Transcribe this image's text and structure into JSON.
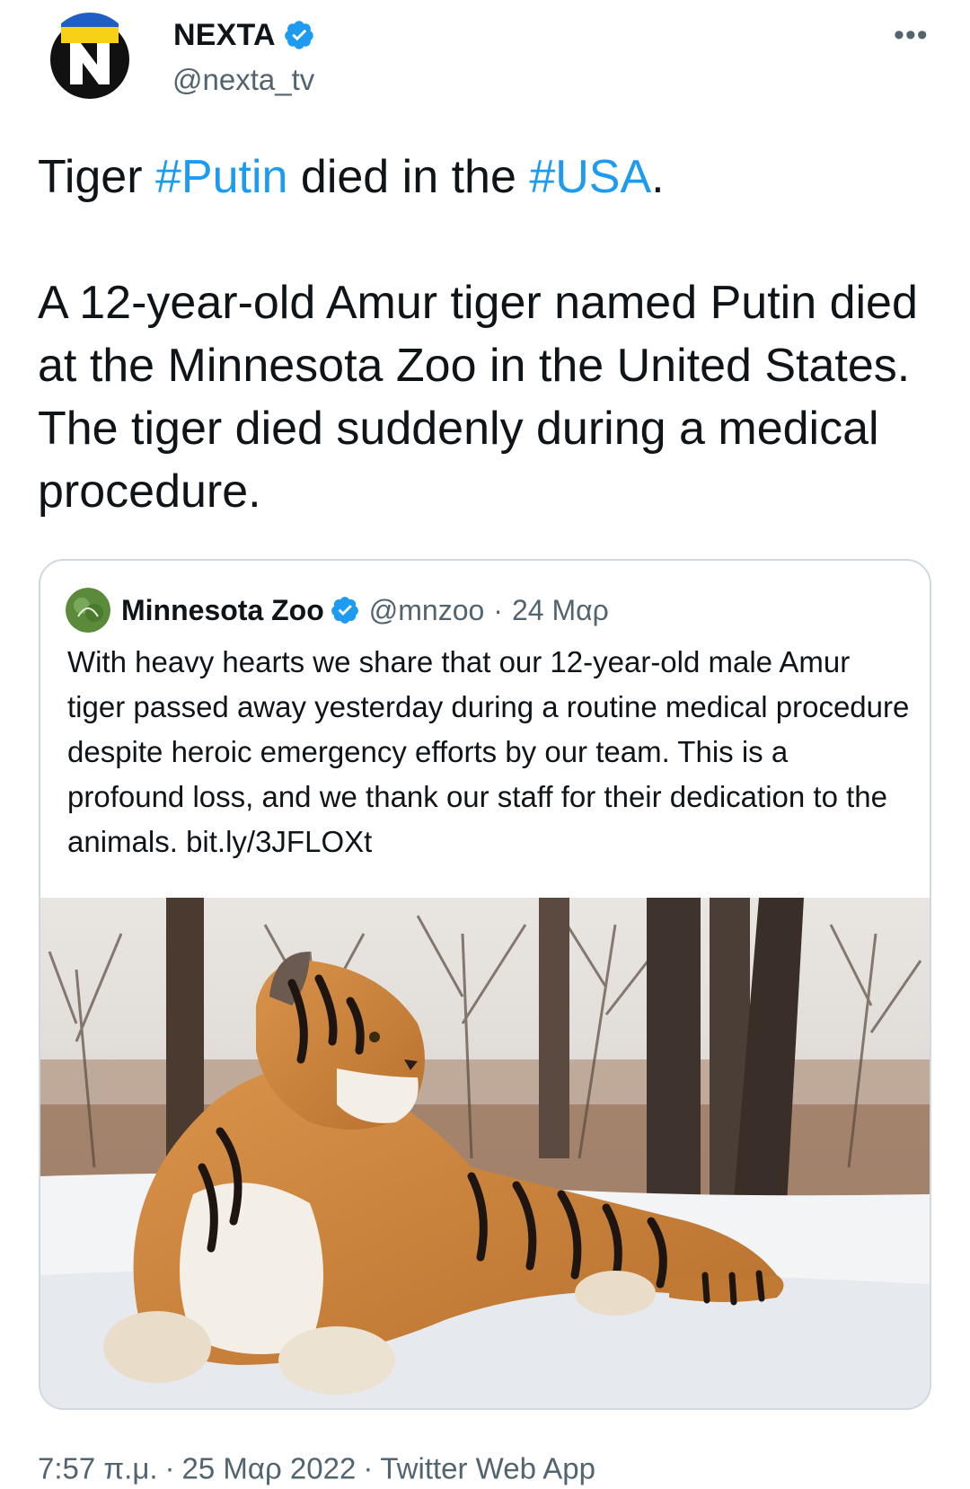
{
  "tweet": {
    "author_name": "NEXTA",
    "author_handle": "@nexta_tv",
    "more_icon": "more-horizontal-icon",
    "text": {
      "word_tiger": "Tiger ",
      "hashtag_1": "#Putin",
      "middle": " died in the ",
      "hashtag_2": "#USA",
      "end": ".",
      "paragraph_2": "A 12-year-old Amur tiger named Putin died at the Minnesota Zoo in the United States. The tiger died suddenly during a medical procedure."
    },
    "time": "7:57 π.μ.",
    "separator": "·",
    "date": "25 Μαρ 2022",
    "source": "Twitter Web App"
  },
  "quoted": {
    "author_name": "Minnesota Zoo",
    "author_handle": "@mnzoo",
    "separator": "·",
    "date": "24 Μαρ",
    "text": "With heavy hearts we share that our 12-year-old male Amur tiger passed away yesterday during a routine medical procedure despite heroic emergency efforts by our team. This is a profound loss, and we thank our staff for their dedication to the animals. ",
    "link": "bit.ly/3JFLOXt"
  },
  "colors": {
    "accent": "#1d9bf0",
    "secondary_text": "#536471",
    "border": "#cfd9de"
  }
}
